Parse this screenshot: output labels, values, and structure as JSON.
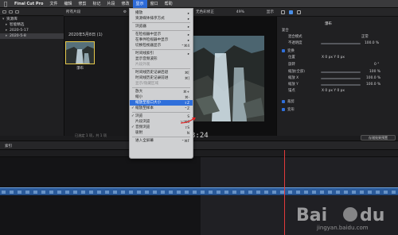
{
  "menubar": {
    "app_name": "Final Cut Pro",
    "items": [
      "文件",
      "编辑",
      "修剪",
      "标记",
      "片段",
      "修改",
      "显示",
      "窗口",
      "帮助"
    ],
    "active_index": 6
  },
  "library": {
    "header_label": "资源库",
    "items": [
      {
        "label": "资源库",
        "level": 0,
        "expanded": true
      },
      {
        "label": "智能精选",
        "level": 1,
        "expanded": false
      },
      {
        "label": "2020-5-17",
        "level": 1,
        "expanded": false
      },
      {
        "label": "2020-5-8",
        "level": 1,
        "expanded": false,
        "selected": true
      }
    ]
  },
  "browser": {
    "header_left": "所有片段",
    "date_header": "2020年5月8日 (1)",
    "thumbnail_label": "瀑布",
    "status": "已选定 1 项，共 1 项"
  },
  "viewer": {
    "header_left": "无色彩修正",
    "zoom": "49%",
    "header_right": "显示",
    "timecode": "3:24"
  },
  "inspector": {
    "clip_name": "瀑布",
    "rows": [
      {
        "label": "复合",
        "value": ""
      },
      {
        "label": "混合模式",
        "value": "正常"
      },
      {
        "label": "不透明度",
        "value": "100.0 %"
      },
      {
        "label": "变换",
        "value": "",
        "checked": true
      },
      {
        "label": "位置",
        "value": "X  0 px   Y  0 px"
      },
      {
        "label": "旋转",
        "value": "0 °"
      },
      {
        "label": "缩放(全部)",
        "value": "100 %"
      },
      {
        "label": "缩放 X",
        "value": "100.0 %"
      },
      {
        "label": "缩放 Y",
        "value": "100.0 %"
      },
      {
        "label": "锚点",
        "value": "X  0 px   Y  0 px"
      },
      {
        "label": "裁剪",
        "value": "",
        "checked": true
      },
      {
        "label": "变形",
        "value": "",
        "checked": true
      }
    ],
    "save_button_label": "存储效果预置"
  },
  "timeline": {
    "toolbar_label": "索引"
  },
  "display_menu": {
    "items": [
      {
        "label": "播放",
        "shortcut": "",
        "submenu": true
      },
      {
        "label": "资源媒体排序方式",
        "shortcut": "",
        "submenu": true
      },
      {
        "sep": true
      },
      {
        "label": "浏览器",
        "shortcut": "",
        "submenu": true
      },
      {
        "sep": true
      },
      {
        "label": "在检视器中显示",
        "shortcut": "",
        "submenu": true
      },
      {
        "label": "在事件检视器中显示",
        "shortcut": "",
        "submenu": true
      },
      {
        "label": "切换检视器显示",
        "shortcut": "⌃⌘4"
      },
      {
        "sep": true
      },
      {
        "label": "时间线索引",
        "shortcut": "",
        "submenu": true
      },
      {
        "label": "显示音频波形",
        "shortcut": ""
      },
      {
        "label": "片段外观",
        "shortcut": "",
        "disabled": true
      },
      {
        "sep": true
      },
      {
        "label": "时间线历史记录后退",
        "shortcut": "⌘["
      },
      {
        "label": "时间线历史记录前进",
        "shortcut": "⌘]"
      },
      {
        "label": "显示/隐藏区域",
        "shortcut": "",
        "disabled": true
      },
      {
        "sep": true
      },
      {
        "label": "放大",
        "shortcut": "⌘+"
      },
      {
        "label": "缩小",
        "shortcut": "⌘-"
      },
      {
        "label": "缩放至窗口大小",
        "shortcut": "⇧Z",
        "highlighted": true
      },
      {
        "label": "缩放至样本",
        "shortcut": "⌃Z",
        "checked": true
      },
      {
        "sep": true
      },
      {
        "label": "浏览",
        "shortcut": "S",
        "checked": true
      },
      {
        "label": "片段浏览",
        "shortcut": "⌥⌘S"
      },
      {
        "label": "音频浏览",
        "shortcut": "⇧S",
        "checked": true
      },
      {
        "label": "吸附",
        "shortcut": "N"
      },
      {
        "sep": true
      },
      {
        "label": "进入全屏幕",
        "shortcut": "⌃⌘F"
      }
    ]
  },
  "watermark": {
    "brand": "Baidu",
    "sub": "jingyan.baidu.com"
  },
  "colors": {
    "menu_highlight": "#2f6fdb",
    "playhead": "#e23b3b",
    "clip": "#2a5a9a",
    "selection": "#e6c84a"
  }
}
